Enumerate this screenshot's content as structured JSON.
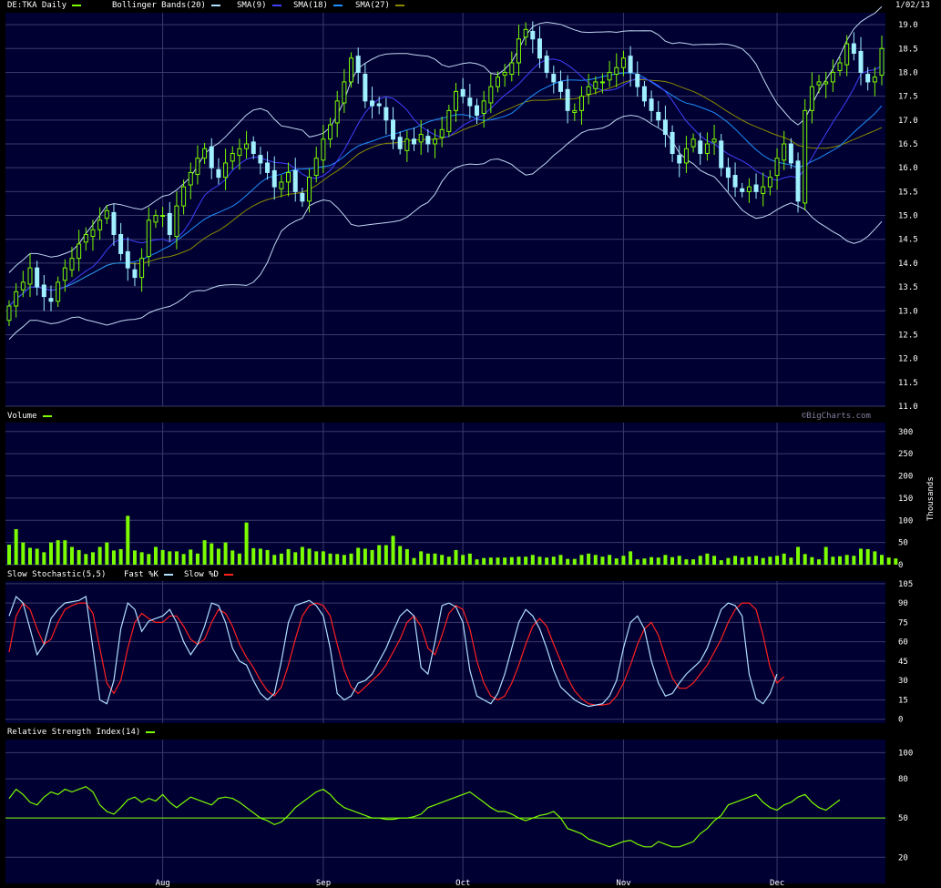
{
  "panels": {
    "price": {
      "legend": [
        {
          "text": "DE:TKA Daily",
          "color": "#7CFC00"
        },
        {
          "text": "Bollinger Bands(20)",
          "color": "#b0e0ff"
        },
        {
          "text": "SMA(9)",
          "color": "#4040ff"
        },
        {
          "text": "SMA(18)",
          "color": "#1e90ff"
        },
        {
          "text": "SMA(27)",
          "color": "#8a8a00"
        }
      ],
      "date_label": "1/02/13"
    },
    "volume": {
      "legend": [
        {
          "text": "Volume",
          "color": "#7CFC00"
        }
      ],
      "watermark": "©BigCharts.com",
      "unit_label": "Thousands"
    },
    "stochastic": {
      "legend": [
        {
          "text": "Slow Stochastic(5,5)",
          "color": ""
        },
        {
          "text": "Fast %K",
          "color": "#b0e0ff"
        },
        {
          "text": "Slow %D",
          "color": "#ff2020"
        }
      ]
    },
    "rsi": {
      "legend": [
        {
          "text": "Relative Strength Index(14)",
          "color": "#7CFC00"
        }
      ]
    }
  },
  "x_axis": {
    "months": [
      "Aug",
      "Sep",
      "Oct",
      "Nov",
      "Dec"
    ]
  },
  "colors": {
    "background": "#000000",
    "plot_bg": "#000033",
    "grid": "#3a3a6a",
    "up": "#7CFC00",
    "down": "#a0f0ff",
    "bb": "#c0d8f0",
    "sma9": "#4040ff",
    "sma18": "#1e90ff",
    "sma27": "#8a8a00",
    "k": "#b0e0ff",
    "d": "#ff2020",
    "vol": "#7CFC00",
    "rsi": "#7CFC00"
  },
  "chart_data": [
    {
      "type": "candlestick",
      "title": "DE:TKA Daily",
      "x": [
        "2012-07-02",
        "2012-07-03",
        "2012-07-04",
        "2012-07-05",
        "2012-07-06",
        "2012-07-09",
        "2012-07-10",
        "2012-07-11",
        "2012-07-12",
        "2012-07-13",
        "2012-07-16",
        "2012-07-17",
        "2012-07-18",
        "2012-07-19",
        "2012-07-20",
        "2012-07-23",
        "2012-07-24",
        "2012-07-25",
        "2012-07-26",
        "2012-07-27",
        "2012-07-30",
        "2012-07-31",
        "2012-08-01",
        "2012-08-02",
        "2012-08-03",
        "2012-08-06",
        "2012-08-07",
        "2012-08-08",
        "2012-08-09",
        "2012-08-10",
        "2012-08-13",
        "2012-08-14",
        "2012-08-15",
        "2012-08-16",
        "2012-08-17",
        "2012-08-20",
        "2012-08-21",
        "2012-08-22",
        "2012-08-23",
        "2012-08-24",
        "2012-08-27",
        "2012-08-28",
        "2012-08-29",
        "2012-08-30",
        "2012-08-31",
        "2012-09-03",
        "2012-09-04",
        "2012-09-05",
        "2012-09-06",
        "2012-09-07",
        "2012-09-10",
        "2012-09-11",
        "2012-09-12",
        "2012-09-13",
        "2012-09-14",
        "2012-09-17",
        "2012-09-18",
        "2012-09-19",
        "2012-09-20",
        "2012-09-21",
        "2012-09-24",
        "2012-09-25",
        "2012-09-26",
        "2012-09-27",
        "2012-09-28",
        "2012-10-01",
        "2012-10-02",
        "2012-10-03",
        "2012-10-04",
        "2012-10-05",
        "2012-10-08",
        "2012-10-09",
        "2012-10-10",
        "2012-10-11",
        "2012-10-12",
        "2012-10-15",
        "2012-10-16",
        "2012-10-17",
        "2012-10-18",
        "2012-10-19",
        "2012-10-22",
        "2012-10-23",
        "2012-10-24",
        "2012-10-25",
        "2012-10-26",
        "2012-10-29",
        "2012-10-30",
        "2012-10-31",
        "2012-11-01",
        "2012-11-02",
        "2012-11-05",
        "2012-11-06",
        "2012-11-07",
        "2012-11-08",
        "2012-11-09",
        "2012-11-12",
        "2012-11-13",
        "2012-11-14",
        "2012-11-15",
        "2012-11-16",
        "2012-11-19",
        "2012-11-20",
        "2012-11-21",
        "2012-11-22",
        "2012-11-23",
        "2012-11-26",
        "2012-11-27",
        "2012-11-28",
        "2012-11-29",
        "2012-11-30",
        "2012-12-03",
        "2012-12-04",
        "2012-12-05",
        "2012-12-06",
        "2012-12-07",
        "2012-12-10",
        "2012-12-11",
        "2012-12-12",
        "2012-12-13",
        "2012-12-14",
        "2012-12-17",
        "2012-12-18",
        "2012-12-19",
        "2012-12-20",
        "2012-12-21",
        "2012-12-27",
        "2012-12-28",
        "2013-01-02"
      ],
      "close": [
        13.1,
        13.4,
        13.6,
        13.9,
        13.5,
        13.3,
        13.2,
        13.6,
        13.9,
        14.1,
        14.4,
        14.6,
        14.7,
        14.9,
        15.1,
        14.6,
        14.2,
        13.9,
        13.7,
        14.1,
        14.9,
        15.0,
        15.0,
        14.6,
        15.2,
        15.6,
        15.9,
        16.2,
        16.4,
        16.0,
        15.8,
        16.1,
        16.3,
        16.4,
        16.5,
        16.3,
        16.1,
        15.9,
        15.6,
        15.7,
        15.9,
        15.5,
        15.3,
        15.8,
        16.2,
        16.6,
        16.9,
        17.4,
        17.8,
        18.3,
        18.0,
        17.4,
        17.3,
        17.3,
        17.0,
        16.6,
        16.4,
        16.6,
        16.5,
        16.7,
        16.5,
        16.6,
        16.8,
        17.2,
        17.6,
        17.5,
        17.3,
        17.1,
        17.4,
        17.7,
        17.9,
        18.0,
        18.2,
        18.7,
        18.9,
        18.7,
        18.3,
        18.0,
        17.8,
        17.6,
        17.2,
        17.2,
        17.5,
        17.7,
        17.8,
        17.8,
        18.0,
        18.1,
        18.3,
        18.0,
        17.7,
        17.4,
        17.2,
        17.0,
        16.7,
        16.3,
        16.1,
        16.4,
        16.6,
        16.3,
        16.5,
        16.6,
        16.0,
        15.8,
        15.6,
        15.5,
        15.6,
        15.5,
        15.6,
        15.8,
        16.2,
        16.5,
        16.1,
        15.3,
        17.2,
        17.7,
        17.8,
        17.8,
        18.0,
        18.2,
        18.6,
        18.4,
        18.0,
        17.8,
        17.9,
        18.5
      ],
      "volume": [
        45,
        80,
        50,
        38,
        36,
        28,
        50,
        55,
        55,
        40,
        33,
        24,
        28,
        40,
        50,
        32,
        35,
        110,
        32,
        28,
        24,
        40,
        33,
        30,
        30,
        24,
        34,
        25,
        55,
        48,
        36,
        50,
        32,
        25,
        95,
        37,
        36,
        33,
        22,
        25,
        35,
        28,
        40,
        36,
        30,
        30,
        25,
        24,
        22,
        25,
        38,
        36,
        33,
        44,
        44,
        65,
        42,
        35,
        15,
        30,
        25,
        25,
        22,
        18,
        33,
        22,
        25,
        12,
        15,
        16,
        16,
        16,
        17,
        18,
        18,
        22,
        18,
        16,
        18,
        22,
        13,
        13,
        22,
        25,
        22,
        18,
        22,
        14,
        20,
        30,
        12,
        14,
        17,
        16,
        22,
        17,
        20,
        12,
        12,
        20,
        25,
        20,
        10,
        15,
        20,
        16,
        18,
        20,
        15,
        18,
        20,
        25,
        16,
        40,
        24,
        17,
        12,
        40,
        18,
        19,
        22,
        20,
        36,
        35,
        30,
        22,
        16,
        14
      ],
      "ylim": [
        11.0,
        19.25
      ]
    },
    {
      "type": "line",
      "title": "Slow Stochastic(5,5)",
      "series": [
        {
          "name": "Fast %K",
          "values": [
            80,
            95,
            90,
            70,
            50,
            58,
            78,
            85,
            90,
            91,
            92,
            95,
            55,
            15,
            12,
            30,
            70,
            90,
            85,
            68,
            76,
            78,
            80,
            85,
            75,
            60,
            50,
            58,
            72,
            90,
            88,
            75,
            55,
            45,
            42,
            30,
            20,
            15,
            20,
            45,
            75,
            88,
            90,
            92,
            88,
            80,
            55,
            20,
            15,
            18,
            28,
            30,
            35,
            45,
            55,
            68,
            80,
            85,
            80,
            40,
            35,
            60,
            88,
            90,
            87,
            75,
            38,
            18,
            15,
            12,
            20,
            35,
            55,
            75,
            85,
            80,
            70,
            55,
            38,
            25,
            20,
            15,
            12,
            10,
            11,
            12,
            18,
            30,
            55,
            75,
            80,
            70,
            45,
            28,
            18,
            20,
            28,
            35,
            40,
            45,
            55,
            70,
            85,
            90,
            88,
            80,
            35,
            16,
            12,
            20,
            35
          ],
          "color": "#b0e0ff"
        },
        {
          "name": "Slow %D",
          "values": [
            52,
            80,
            90,
            85,
            70,
            58,
            62,
            75,
            85,
            88,
            90,
            90,
            82,
            55,
            28,
            20,
            30,
            55,
            75,
            82,
            78,
            75,
            75,
            80,
            80,
            72,
            62,
            58,
            62,
            75,
            85,
            82,
            72,
            58,
            48,
            40,
            30,
            22,
            18,
            25,
            42,
            62,
            80,
            88,
            90,
            88,
            80,
            58,
            38,
            25,
            20,
            25,
            30,
            35,
            42,
            52,
            62,
            75,
            80,
            72,
            55,
            50,
            65,
            82,
            88,
            85,
            70,
            45,
            28,
            18,
            15,
            18,
            28,
            42,
            58,
            72,
            78,
            72,
            58,
            45,
            32,
            22,
            16,
            12,
            11,
            11,
            12,
            18,
            28,
            42,
            58,
            70,
            75,
            65,
            48,
            32,
            24,
            24,
            28,
            35,
            42,
            52,
            62,
            75,
            85,
            90,
            90,
            85,
            65,
            40,
            28,
            33
          ],
          "color": "#ff2020"
        }
      ],
      "ylim": [
        0,
        105
      ]
    },
    {
      "type": "line",
      "title": "Relative Strength Index(14)",
      "series": [
        {
          "name": "RSI",
          "values": [
            65,
            72,
            68,
            62,
            60,
            66,
            70,
            68,
            72,
            70,
            72,
            74,
            70,
            60,
            55,
            53,
            58,
            64,
            66,
            62,
            65,
            63,
            68,
            62,
            58,
            62,
            66,
            64,
            62,
            60,
            65,
            66,
            65,
            62,
            58,
            54,
            50,
            48,
            45,
            47,
            52,
            58,
            62,
            66,
            70,
            72,
            68,
            62,
            58,
            56,
            54,
            52,
            50,
            50,
            49,
            49,
            50,
            50,
            51,
            53,
            58,
            60,
            62,
            64,
            66,
            68,
            70,
            66,
            62,
            58,
            55,
            55,
            53,
            50,
            48,
            50,
            52,
            53,
            55,
            50,
            42,
            40,
            38,
            34,
            32,
            30,
            28,
            30,
            32,
            33,
            30,
            28,
            28,
            32,
            30,
            28,
            28,
            30,
            32,
            38,
            42,
            48,
            52,
            60,
            62,
            64,
            66,
            68,
            62,
            58,
            56,
            60,
            62,
            66,
            68,
            62,
            58,
            56,
            60,
            64
          ],
          "color": "#7CFC00"
        }
      ],
      "ylim": [
        0,
        100
      ]
    }
  ]
}
